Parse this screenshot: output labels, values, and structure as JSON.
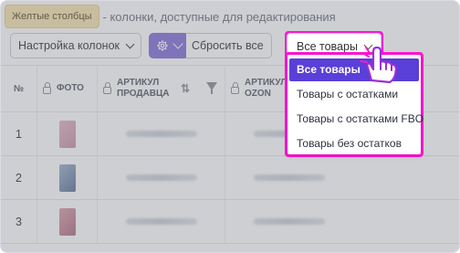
{
  "hint": {
    "tag_label": "Желтые столбцы",
    "text": "- колонки, доступные для редактирования"
  },
  "controls": {
    "columns_button": "Настройка колонок",
    "gear_icon": "gear-icon",
    "reset_button": "Сбросить все"
  },
  "table": {
    "headers": [
      {
        "label": "№"
      },
      {
        "label": "ФОТО"
      },
      {
        "label": "АРТИКУЛ ПРОДАВЦА"
      },
      {
        "label": "АРТИКУЛ OZON"
      }
    ],
    "rows": [
      {
        "number": "1",
        "thumb_color": "#d4a6b6"
      },
      {
        "number": "2",
        "thumb_color": "#8aa0c0"
      },
      {
        "number": "3",
        "thumb_color": "#c98a9a"
      }
    ]
  },
  "dropdown": {
    "selected": "Все товары",
    "options": [
      {
        "label": "Все товары",
        "active": true
      },
      {
        "label": "Товары с остатками",
        "active": false
      },
      {
        "label": "Товары с остатками FBO",
        "active": false
      },
      {
        "label": "Товары без остатков",
        "active": false
      }
    ]
  },
  "colors": {
    "accent": "#5a3fd8",
    "highlight": "#ff15d6",
    "gear_button": "#8470d9",
    "yellow_tag": "#f6e3b0"
  }
}
